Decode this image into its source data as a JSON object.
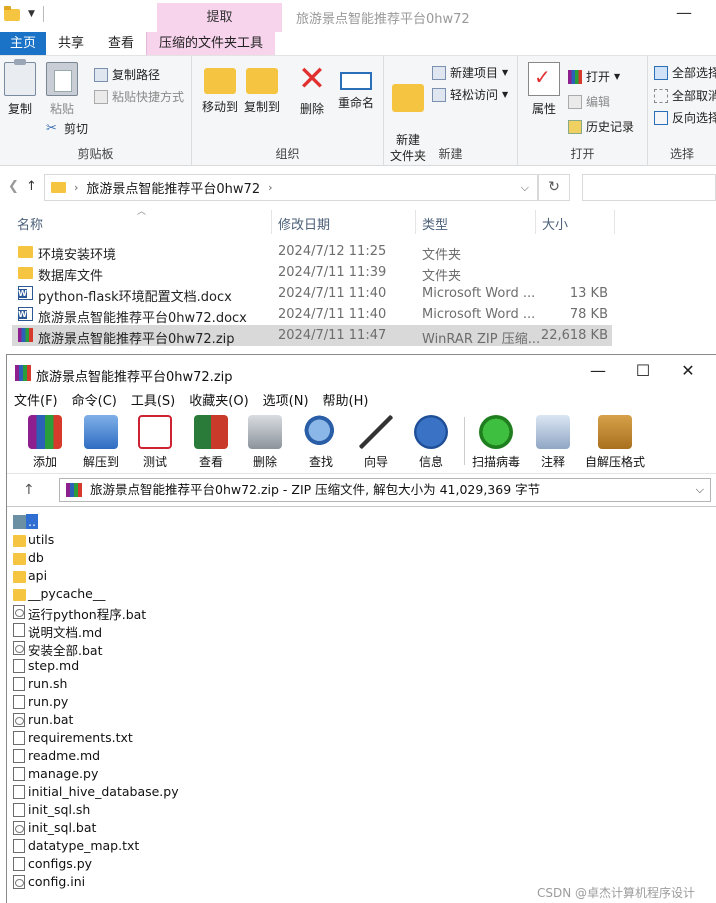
{
  "explorer": {
    "window_title": "旅游景点智能推荐平台0hw72",
    "context_tab_header": "提取",
    "tabs": [
      "主页",
      "共享",
      "查看",
      "压缩的文件夹工具"
    ],
    "ribbon": {
      "clipboard": {
        "label": "剪贴板",
        "copy": "复制",
        "paste": "粘贴",
        "copy_path": "复制路径",
        "paste_shortcut": "粘贴快捷方式",
        "cut": "剪切"
      },
      "organize": {
        "label": "组织",
        "move_to": "移动到",
        "copy_to": "复制到",
        "delete": "删除",
        "rename": "重命名"
      },
      "new": {
        "label": "新建",
        "new_folder": "新建\n文件夹",
        "new_item": "新建项目",
        "easy_access": "轻松访问"
      },
      "open": {
        "label": "打开",
        "properties": "属性",
        "open": "打开",
        "edit": "编辑",
        "history": "历史记录"
      },
      "select": {
        "label": "选择",
        "select_all": "全部选择",
        "select_none": "全部取消",
        "invert": "反向选择"
      }
    },
    "address": {
      "path": "旅游景点智能推荐平台0hw72"
    },
    "columns": {
      "name": "名称",
      "date": "修改日期",
      "type": "类型",
      "size": "大小"
    },
    "files": [
      {
        "name": "环境安装环境",
        "date": "2024/7/12 11:25",
        "type": "文件夹",
        "size": "",
        "icon": "folder"
      },
      {
        "name": "数据库文件",
        "date": "2024/7/11 11:39",
        "type": "文件夹",
        "size": "",
        "icon": "folder"
      },
      {
        "name": "python-flask环境配置文档.docx",
        "date": "2024/7/11 11:40",
        "type": "Microsoft Word ...",
        "size": "13 KB",
        "icon": "word"
      },
      {
        "name": "旅游景点智能推荐平台0hw72.docx",
        "date": "2024/7/11 11:40",
        "type": "Microsoft Word ...",
        "size": "78 KB",
        "icon": "word"
      },
      {
        "name": "旅游景点智能推荐平台0hw72.zip",
        "date": "2024/7/11 11:47",
        "type": "WinRAR ZIP 压缩...",
        "size": "22,618 KB",
        "icon": "rar"
      }
    ]
  },
  "winrar": {
    "title": "旅游景点智能推荐平台0hw72.zip",
    "menu": [
      "文件(F)",
      "命令(C)",
      "工具(S)",
      "收藏夹(O)",
      "选项(N)",
      "帮助(H)"
    ],
    "toolbar": [
      "添加",
      "解压到",
      "测试",
      "查看",
      "删除",
      "查找",
      "向导",
      "信息",
      "扫描病毒",
      "注释",
      "自解压格式"
    ],
    "path_text": "旅游景点智能推荐平台0hw72.zip - ZIP 压缩文件, 解包大小为 41,029,369 字节",
    "entries": [
      {
        "name": "..",
        "icon": "up"
      },
      {
        "name": "utils",
        "icon": "folder"
      },
      {
        "name": "db",
        "icon": "folder"
      },
      {
        "name": "api",
        "icon": "folder"
      },
      {
        "name": "__pycache__",
        "icon": "folder"
      },
      {
        "name": "运行python程序.bat",
        "icon": "bat"
      },
      {
        "name": "说明文档.md",
        "icon": "file"
      },
      {
        "name": "安装全部.bat",
        "icon": "bat"
      },
      {
        "name": "step.md",
        "icon": "file"
      },
      {
        "name": "run.sh",
        "icon": "file"
      },
      {
        "name": "run.py",
        "icon": "file"
      },
      {
        "name": "run.bat",
        "icon": "bat"
      },
      {
        "name": "requirements.txt",
        "icon": "file"
      },
      {
        "name": "readme.md",
        "icon": "file"
      },
      {
        "name": "manage.py",
        "icon": "file"
      },
      {
        "name": "initial_hive_database.py",
        "icon": "file"
      },
      {
        "name": "init_sql.sh",
        "icon": "file"
      },
      {
        "name": "init_sql.bat",
        "icon": "bat"
      },
      {
        "name": "datatype_map.txt",
        "icon": "file"
      },
      {
        "name": "configs.py",
        "icon": "file"
      },
      {
        "name": "config.ini",
        "icon": "bat"
      }
    ],
    "watermark": "CSDN @卓杰计算机程序设计"
  }
}
